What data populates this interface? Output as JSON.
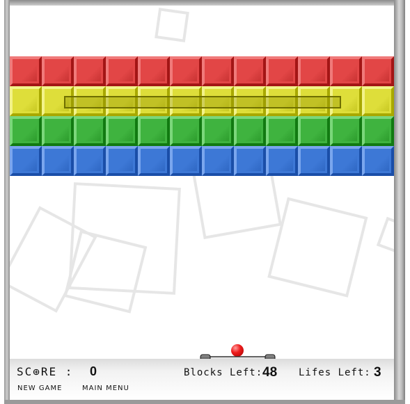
{
  "hud": {
    "score_label": "SC⊕RE :",
    "score_value": "0",
    "blocks_label": "Blocks Left:",
    "blocks_value": "48",
    "lifes_label": "Lifes Left:",
    "lifes_value": "3"
  },
  "menu": {
    "new_game": "NEW GAME",
    "main_menu": "MAIN MENU"
  },
  "bricks": {
    "rows": [
      {
        "color": "red",
        "face": "#e24646",
        "light": "#f07a7a",
        "dark": "#a31515",
        "count": 12
      },
      {
        "color": "yellow",
        "face": "#dede3a",
        "light": "#f3f38a",
        "dark": "#a8a800",
        "count": 12
      },
      {
        "color": "green",
        "face": "#3fb33f",
        "light": "#7bd77b",
        "dark": "#117a11",
        "count": 12
      },
      {
        "color": "blue",
        "face": "#3d78d6",
        "light": "#7aa6ee",
        "dark": "#1a4ea8",
        "count": 12
      }
    ]
  },
  "colors": {
    "ball": "#ee1d1d",
    "paddle": "#c8c8c8",
    "frame": "#a8a8a8"
  }
}
